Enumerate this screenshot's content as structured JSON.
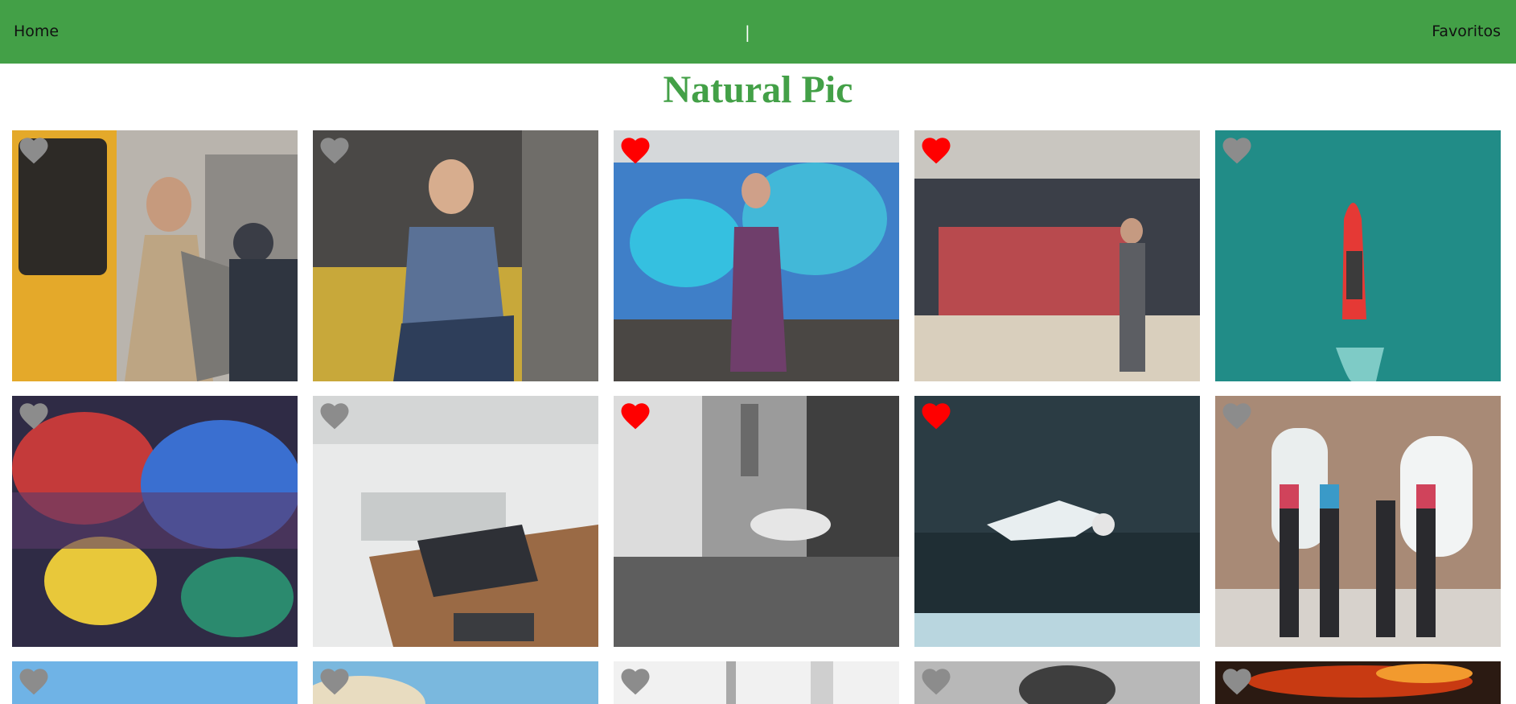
{
  "nav": {
    "home_label": "Home",
    "separator": "|",
    "favorites_label": "Favoritos"
  },
  "title": "Natural Pic",
  "colors": {
    "brand_green": "#43a047",
    "heart_favorite": "#ff0000",
    "heart_default": "#8c8c8c"
  },
  "photos": [
    {
      "subject": "man-with-backpack-at-train",
      "favorite": false
    },
    {
      "subject": "man-writing-on-yellow-couch",
      "favorite": false
    },
    {
      "subject": "woman-with-blue-smoke",
      "favorite": true
    },
    {
      "subject": "auditorium-audience",
      "favorite": true
    },
    {
      "subject": "red-boat-on-teal-water",
      "favorite": false
    },
    {
      "subject": "crowd-with-colored-smoke",
      "favorite": false
    },
    {
      "subject": "laptop-on-wooden-desk",
      "favorite": false
    },
    {
      "subject": "crowded-street-black-white",
      "favorite": true
    },
    {
      "subject": "breakdancer-mid-air",
      "favorite": true
    },
    {
      "subject": "women-exercising-with-dumbbells",
      "favorite": false
    },
    {
      "subject": "blue-sky",
      "favorite": false
    },
    {
      "subject": "sunlit-sky",
      "favorite": false
    },
    {
      "subject": "white-building",
      "favorite": false
    },
    {
      "subject": "black-white-portrait",
      "favorite": false
    },
    {
      "subject": "fire-lights",
      "favorite": false
    }
  ]
}
